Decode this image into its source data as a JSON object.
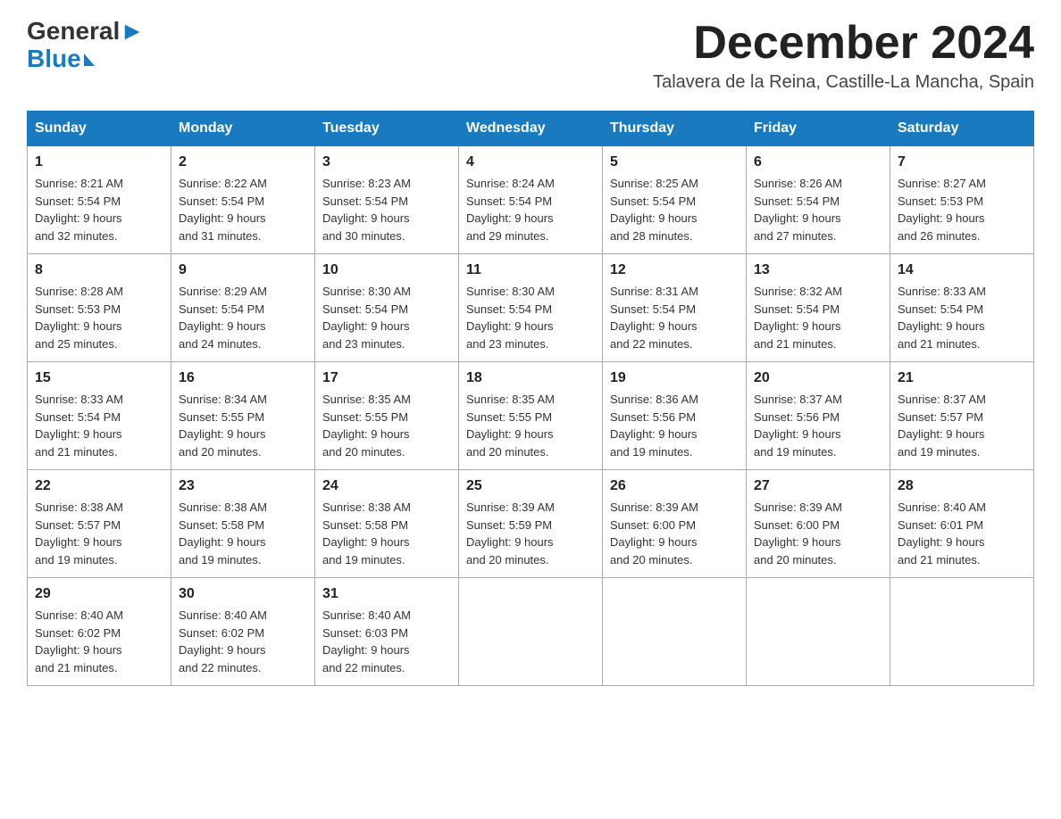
{
  "logo": {
    "part1": "General",
    "part2": "Blue"
  },
  "header": {
    "title": "December 2024",
    "location": "Talavera de la Reina, Castille-La Mancha, Spain"
  },
  "days_of_week": [
    "Sunday",
    "Monday",
    "Tuesday",
    "Wednesday",
    "Thursday",
    "Friday",
    "Saturday"
  ],
  "weeks": [
    [
      {
        "day": "1",
        "sunrise": "8:21 AM",
        "sunset": "5:54 PM",
        "daylight": "9 hours and 32 minutes."
      },
      {
        "day": "2",
        "sunrise": "8:22 AM",
        "sunset": "5:54 PM",
        "daylight": "9 hours and 31 minutes."
      },
      {
        "day": "3",
        "sunrise": "8:23 AM",
        "sunset": "5:54 PM",
        "daylight": "9 hours and 30 minutes."
      },
      {
        "day": "4",
        "sunrise": "8:24 AM",
        "sunset": "5:54 PM",
        "daylight": "9 hours and 29 minutes."
      },
      {
        "day": "5",
        "sunrise": "8:25 AM",
        "sunset": "5:54 PM",
        "daylight": "9 hours and 28 minutes."
      },
      {
        "day": "6",
        "sunrise": "8:26 AM",
        "sunset": "5:54 PM",
        "daylight": "9 hours and 27 minutes."
      },
      {
        "day": "7",
        "sunrise": "8:27 AM",
        "sunset": "5:53 PM",
        "daylight": "9 hours and 26 minutes."
      }
    ],
    [
      {
        "day": "8",
        "sunrise": "8:28 AM",
        "sunset": "5:53 PM",
        "daylight": "9 hours and 25 minutes."
      },
      {
        "day": "9",
        "sunrise": "8:29 AM",
        "sunset": "5:54 PM",
        "daylight": "9 hours and 24 minutes."
      },
      {
        "day": "10",
        "sunrise": "8:30 AM",
        "sunset": "5:54 PM",
        "daylight": "9 hours and 23 minutes."
      },
      {
        "day": "11",
        "sunrise": "8:30 AM",
        "sunset": "5:54 PM",
        "daylight": "9 hours and 23 minutes."
      },
      {
        "day": "12",
        "sunrise": "8:31 AM",
        "sunset": "5:54 PM",
        "daylight": "9 hours and 22 minutes."
      },
      {
        "day": "13",
        "sunrise": "8:32 AM",
        "sunset": "5:54 PM",
        "daylight": "9 hours and 21 minutes."
      },
      {
        "day": "14",
        "sunrise": "8:33 AM",
        "sunset": "5:54 PM",
        "daylight": "9 hours and 21 minutes."
      }
    ],
    [
      {
        "day": "15",
        "sunrise": "8:33 AM",
        "sunset": "5:54 PM",
        "daylight": "9 hours and 21 minutes."
      },
      {
        "day": "16",
        "sunrise": "8:34 AM",
        "sunset": "5:55 PM",
        "daylight": "9 hours and 20 minutes."
      },
      {
        "day": "17",
        "sunrise": "8:35 AM",
        "sunset": "5:55 PM",
        "daylight": "9 hours and 20 minutes."
      },
      {
        "day": "18",
        "sunrise": "8:35 AM",
        "sunset": "5:55 PM",
        "daylight": "9 hours and 20 minutes."
      },
      {
        "day": "19",
        "sunrise": "8:36 AM",
        "sunset": "5:56 PM",
        "daylight": "9 hours and 19 minutes."
      },
      {
        "day": "20",
        "sunrise": "8:37 AM",
        "sunset": "5:56 PM",
        "daylight": "9 hours and 19 minutes."
      },
      {
        "day": "21",
        "sunrise": "8:37 AM",
        "sunset": "5:57 PM",
        "daylight": "9 hours and 19 minutes."
      }
    ],
    [
      {
        "day": "22",
        "sunrise": "8:38 AM",
        "sunset": "5:57 PM",
        "daylight": "9 hours and 19 minutes."
      },
      {
        "day": "23",
        "sunrise": "8:38 AM",
        "sunset": "5:58 PM",
        "daylight": "9 hours and 19 minutes."
      },
      {
        "day": "24",
        "sunrise": "8:38 AM",
        "sunset": "5:58 PM",
        "daylight": "9 hours and 19 minutes."
      },
      {
        "day": "25",
        "sunrise": "8:39 AM",
        "sunset": "5:59 PM",
        "daylight": "9 hours and 20 minutes."
      },
      {
        "day": "26",
        "sunrise": "8:39 AM",
        "sunset": "6:00 PM",
        "daylight": "9 hours and 20 minutes."
      },
      {
        "day": "27",
        "sunrise": "8:39 AM",
        "sunset": "6:00 PM",
        "daylight": "9 hours and 20 minutes."
      },
      {
        "day": "28",
        "sunrise": "8:40 AM",
        "sunset": "6:01 PM",
        "daylight": "9 hours and 21 minutes."
      }
    ],
    [
      {
        "day": "29",
        "sunrise": "8:40 AM",
        "sunset": "6:02 PM",
        "daylight": "9 hours and 21 minutes."
      },
      {
        "day": "30",
        "sunrise": "8:40 AM",
        "sunset": "6:02 PM",
        "daylight": "9 hours and 22 minutes."
      },
      {
        "day": "31",
        "sunrise": "8:40 AM",
        "sunset": "6:03 PM",
        "daylight": "9 hours and 22 minutes."
      },
      null,
      null,
      null,
      null
    ]
  ],
  "labels": {
    "sunrise": "Sunrise:",
    "sunset": "Sunset:",
    "daylight": "Daylight:"
  }
}
